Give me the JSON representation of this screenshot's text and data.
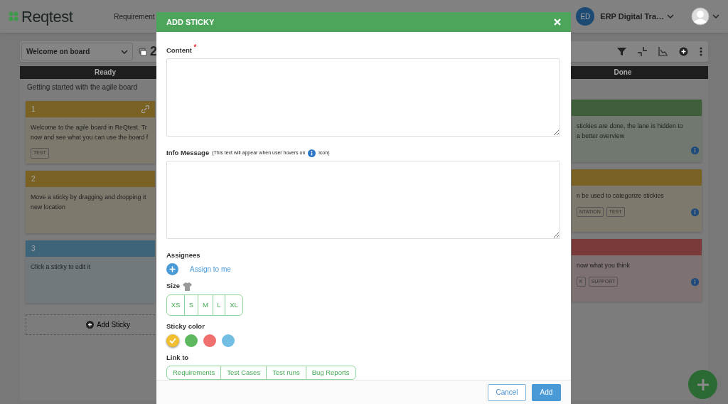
{
  "header": {
    "logo": "Reqtest",
    "nav": [
      "Requirement"
    ],
    "account": {
      "initials": "ED",
      "name": "ERP Digital Tra…"
    }
  },
  "toolbar": {
    "board_select": "Welcome on board",
    "count": "2"
  },
  "lanes": [
    {
      "title": "Ready",
      "subtitle": "Getting started with the agile board",
      "add_label": "Add Sticky",
      "stickies": [
        {
          "number": "1",
          "color": "#7a6224",
          "text": "Welcome to the agile board in ReQtest. Tr\nnow and see what you can use the board f",
          "tags": [
            "TEST"
          ],
          "linked": true,
          "info": false
        },
        {
          "number": "2",
          "color": "#7a6224",
          "text": "Move a sticky by dragging and dropping it\nnew location",
          "linked": false,
          "info": false
        },
        {
          "number": "3",
          "color": "#3d6478",
          "text": "Click a sticky to edit it",
          "linked": false,
          "info": false
        }
      ]
    },
    {
      "title": "Done",
      "stickies": [
        {
          "color": "#3d5e38",
          "text": "stickies are done, the lane is hidden to\na better overview",
          "linked": false,
          "info": true
        },
        {
          "color": "#7a6224",
          "text": "n be used to categorize stickies",
          "tags": [
            "NTATION",
            "TEST"
          ],
          "linked": false,
          "info": true
        },
        {
          "color": "#7a3a3a",
          "text": "now what you think",
          "tags": [
            "K",
            "SUPPORT"
          ],
          "linked": false,
          "info": true
        }
      ]
    }
  ],
  "modal": {
    "title": "ADD STICKY",
    "content_label": "Content",
    "required_mark": "*",
    "info_label": "Info Message",
    "info_note_before": "(This text will appear when user hovers on",
    "info_note_after": "icon)",
    "assignees_label": "Assignees",
    "assign_link": "Assign to me",
    "size_label": "Size",
    "sizes": [
      {
        "label": "XS",
        "selected": false
      },
      {
        "label": "S",
        "selected": false
      },
      {
        "label": "M",
        "selected": false
      },
      {
        "label": "L",
        "selected": false
      },
      {
        "label": "XL",
        "selected": false
      }
    ],
    "color_label": "Sticky color",
    "colors": [
      {
        "color": "#f0be2e",
        "selected": true
      },
      {
        "color": "#5db860",
        "selected": false
      },
      {
        "color": "#f07070",
        "selected": false
      },
      {
        "color": "#72bfe3",
        "selected": false
      }
    ],
    "link_label": "Link to",
    "links": [
      "Requirements",
      "Test Cases",
      "Test runs",
      "Bug Reports"
    ],
    "cancel": "Cancel",
    "add": "Add"
  }
}
